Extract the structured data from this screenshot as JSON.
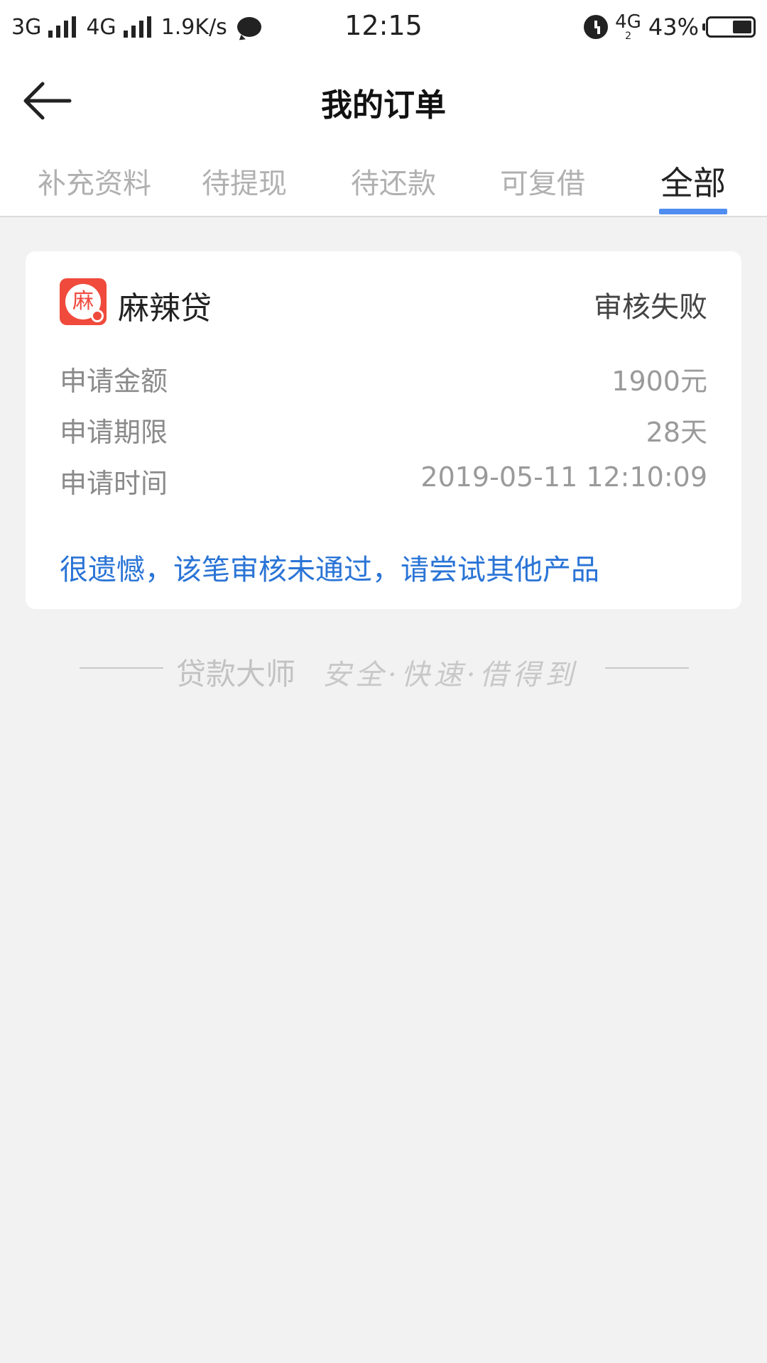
{
  "status_bar": {
    "network1": "3G",
    "network2": "4G",
    "speed": "1.9K/s",
    "time": "12:15",
    "net_mini": "4G",
    "net_mini_sub": "2",
    "battery": "43%"
  },
  "header": {
    "title": "我的订单"
  },
  "tabs": [
    {
      "label": "补充资料"
    },
    {
      "label": "待提现"
    },
    {
      "label": "待还款"
    },
    {
      "label": "可复借"
    },
    {
      "label": "全部"
    }
  ],
  "order": {
    "product_logo_char": "麻",
    "product_name": "麻辣贷",
    "status": "审核失败",
    "fields": [
      {
        "label": "申请金额",
        "value": "1900元"
      },
      {
        "label": "申请期限",
        "value": "28天"
      },
      {
        "label": "申请时间",
        "value": "2019-05-11 12:10:09"
      }
    ],
    "notice": "很遗憾，该笔审核未通过，请尝试其他产品"
  },
  "footer": {
    "brand": "贷款大师",
    "motto": "安全·快速·借得到"
  },
  "colors": {
    "accent": "#4f8df0",
    "notice": "#2a74d6",
    "logo": "#f04a3c",
    "background": "#f2f2f2"
  }
}
